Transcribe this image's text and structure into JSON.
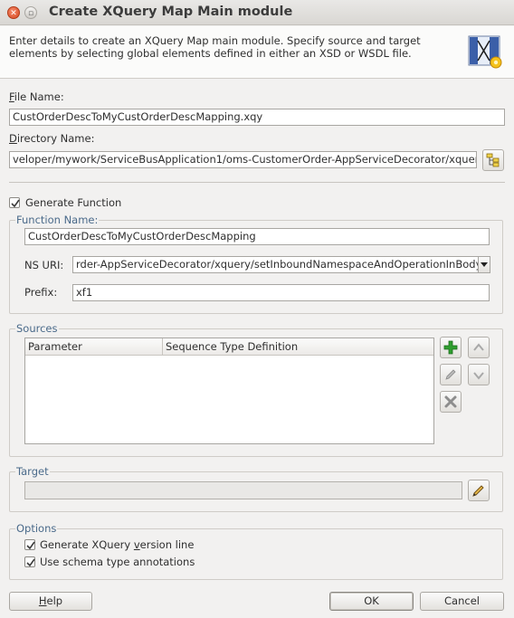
{
  "window": {
    "title": "Create XQuery Map Main module"
  },
  "header": {
    "description": "Enter details to create an XQuery Map main module. Specify source and target elements by selecting global elements defined in either an XSD or WSDL file.",
    "icon": "xquery-map-wizard-icon"
  },
  "file_name": {
    "label_mnemonic": "F",
    "label_rest": "ile Name:",
    "value": "CustOrderDescToMyCustOrderDescMapping.xqy"
  },
  "directory": {
    "label_mnemonic": "D",
    "label_rest": "irectory Name:",
    "value": "veloper/mywork/ServiceBusApplication1/oms-CustomerOrder-AppServiceDecorator/xquery",
    "browse_icon": "browse-folder-icon"
  },
  "generate_function": {
    "label": "Generate Function",
    "checked": true
  },
  "function_group": {
    "title": "Function Name:",
    "function_name_value": "CustOrderDescToMyCustOrderDescMapping",
    "ns_uri_label": "NS URI:",
    "ns_uri_value": "rder-AppServiceDecorator/xquery/setInboundNamespaceAndOperationInBody/",
    "prefix_label": "Prefix:",
    "prefix_value": "xf1"
  },
  "sources": {
    "title": "Sources",
    "columns": [
      "Parameter",
      "Sequence Type Definition"
    ],
    "rows": [],
    "buttons": [
      "add-icon",
      "edit-icon",
      "delete-icon",
      "move-up-icon",
      "move-down-icon"
    ]
  },
  "target": {
    "title": "Target",
    "value": "",
    "edit_icon": "edit-pencil-icon"
  },
  "options": {
    "title": "Options",
    "version_line_pre": "Generate XQuery ",
    "version_line_mnemonic": "v",
    "version_line_post": "ersion line",
    "version_line_checked": true,
    "schema_annotations": "Use schema type annotations",
    "schema_annotations_checked": true
  },
  "footer": {
    "help_mnemonic": "H",
    "help_rest": "elp",
    "ok": "OK",
    "cancel": "Cancel"
  },
  "colors": {
    "group_title": "#4a6a8a",
    "add_green": "#2f9e2f"
  }
}
